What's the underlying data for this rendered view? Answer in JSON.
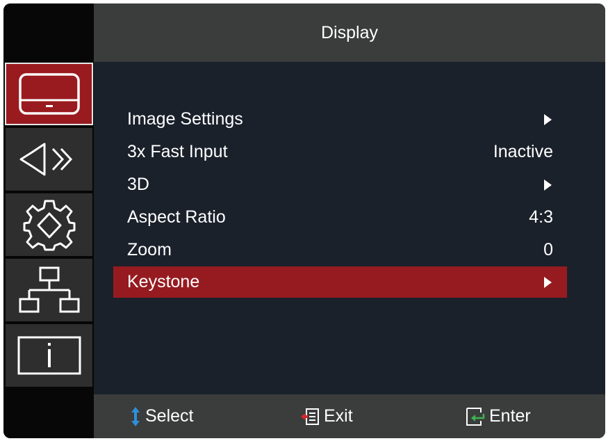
{
  "header": {
    "title": "Display"
  },
  "sidebar": {
    "tabs": [
      {
        "icon": "display-icon",
        "active": true
      },
      {
        "icon": "audio-icon",
        "active": false
      },
      {
        "icon": "system-settings-icon",
        "active": false
      },
      {
        "icon": "network-icon",
        "active": false
      },
      {
        "icon": "information-icon",
        "active": false
      }
    ]
  },
  "menu": {
    "items": [
      {
        "label": "Image Settings",
        "value": "",
        "has_submenu": true
      },
      {
        "label": "3x Fast Input",
        "value": "Inactive",
        "has_submenu": false
      },
      {
        "label": "3D",
        "value": "",
        "has_submenu": true
      },
      {
        "label": "Aspect Ratio",
        "value": "4:3",
        "has_submenu": false
      },
      {
        "label": "Zoom",
        "value": "0",
        "has_submenu": false
      },
      {
        "label": "Keystone",
        "value": "",
        "has_submenu": true,
        "selected": true
      }
    ]
  },
  "footer": {
    "select_label": "Select",
    "exit_label": "Exit",
    "enter_label": "Enter"
  },
  "colors": {
    "accent": "#961b20",
    "background": "#1a212b",
    "bar": "#3a3d3c",
    "icon_blue": "#2f8fd8",
    "icon_green": "#3fb34f",
    "icon_red": "#d9262c"
  }
}
